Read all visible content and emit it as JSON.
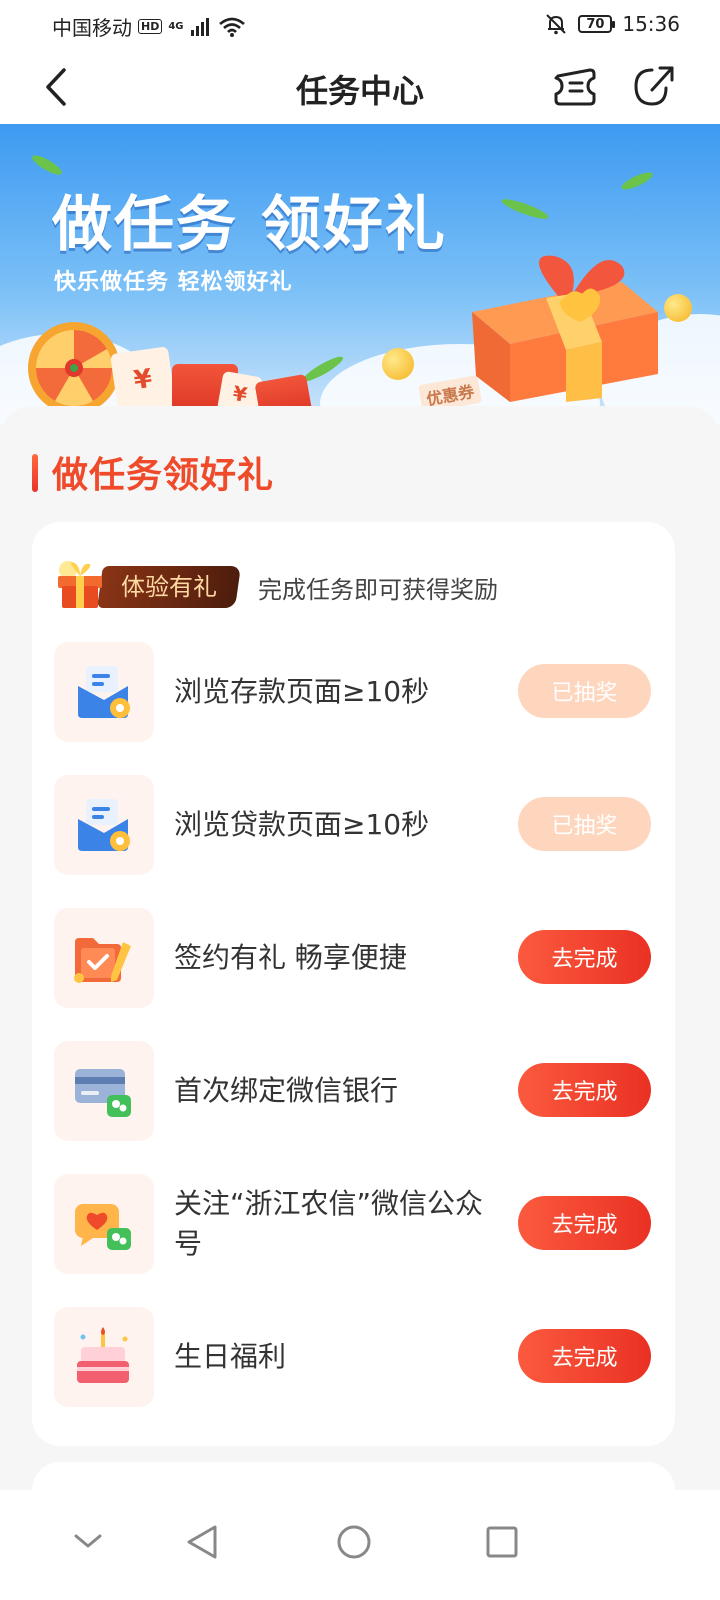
{
  "status_bar": {
    "carrier": "中国移动",
    "hd": "HD",
    "network": "4G",
    "battery": "70",
    "time": "15:36"
  },
  "nav": {
    "title": "任务中心",
    "back_icon": "chevron-left-icon",
    "ticket_icon": "ticket-icon",
    "share_icon": "share-icon"
  },
  "banner": {
    "title": "做任务 领好礼",
    "subtitle": "快乐做任务 轻松领好礼",
    "coupon_text": "优惠券",
    "yen": "¥"
  },
  "section": {
    "title": "做任务领好礼"
  },
  "experience": {
    "badge": "体验有礼",
    "description": "完成任务即可获得奖励"
  },
  "tasks": [
    {
      "label": "浏览存款页面≥10秒",
      "button": "已抽奖",
      "state": "done",
      "icon": "envelope-eye-icon"
    },
    {
      "label": "浏览贷款页面≥10秒",
      "button": "已抽奖",
      "state": "done",
      "icon": "envelope-eye-icon"
    },
    {
      "label": "签约有礼 畅享便捷",
      "button": "去完成",
      "state": "todo",
      "icon": "folder-pencil-icon"
    },
    {
      "label": "首次绑定微信银行",
      "button": "去完成",
      "state": "todo",
      "icon": "card-wechat-icon"
    },
    {
      "label": "关注“浙江农信”微信公众号",
      "button": "去完成",
      "state": "todo",
      "icon": "heart-chat-icon"
    },
    {
      "label": "生日福利",
      "button": "去完成",
      "state": "todo",
      "icon": "birthday-cake-icon"
    }
  ],
  "colors": {
    "accent": "#ef4a2a",
    "button_active": "#f23e2e",
    "button_done": "#fdd6bd",
    "banner_blue": "#3d9af1"
  },
  "system_nav": {
    "icons": [
      "collapse-chevron-icon",
      "back-triangle-icon",
      "home-circle-icon",
      "recents-square-icon"
    ]
  }
}
